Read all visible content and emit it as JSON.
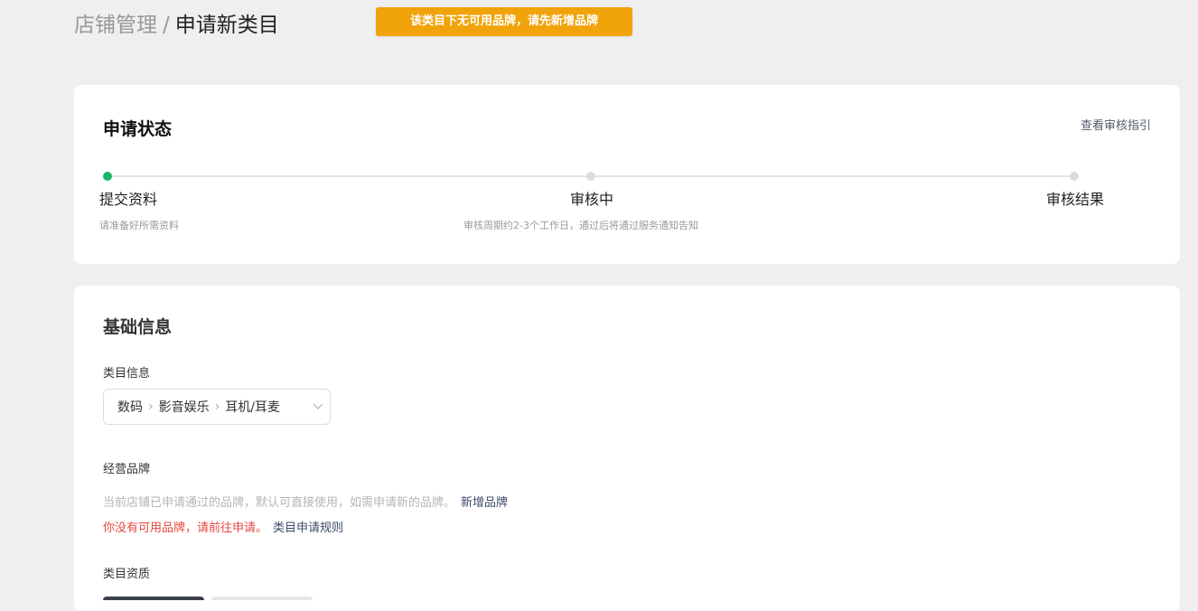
{
  "breadcrumb": {
    "parent": "店铺管理",
    "separator": "/",
    "current": "申请新类目"
  },
  "toast": {
    "message": "该类目下无可用品牌，请先新增品牌",
    "color": "#f0a30a"
  },
  "status_card": {
    "title": "申请状态",
    "guide_link": "查看审核指引",
    "steps": [
      {
        "title": "提交资料",
        "desc": "请准备好所需资料",
        "active": true
      },
      {
        "title": "审核中",
        "desc": "审核周期约2-3个工作日，通过后将通过服务通知告知",
        "active": false
      },
      {
        "title": "审核结果",
        "desc": "",
        "active": false
      }
    ],
    "active_color": "#17b56b"
  },
  "basic_card": {
    "title": "基础信息",
    "category": {
      "label": "类目信息",
      "path": [
        "数码",
        "影音娱乐",
        "耳机/耳麦"
      ],
      "separator_icon": "chevron-right-icon",
      "dropdown_icon": "chevron-down-icon"
    },
    "brand": {
      "label": "经营品牌",
      "hint": "当前店铺已申请通过的品牌，默认可直接使用，如需申请新的品牌。",
      "add_link": "新增品牌",
      "warning": "你没有可用品牌，请前往申请。",
      "rules_link": "类目申请规则"
    },
    "qualification": {
      "label": "类目资质"
    }
  }
}
